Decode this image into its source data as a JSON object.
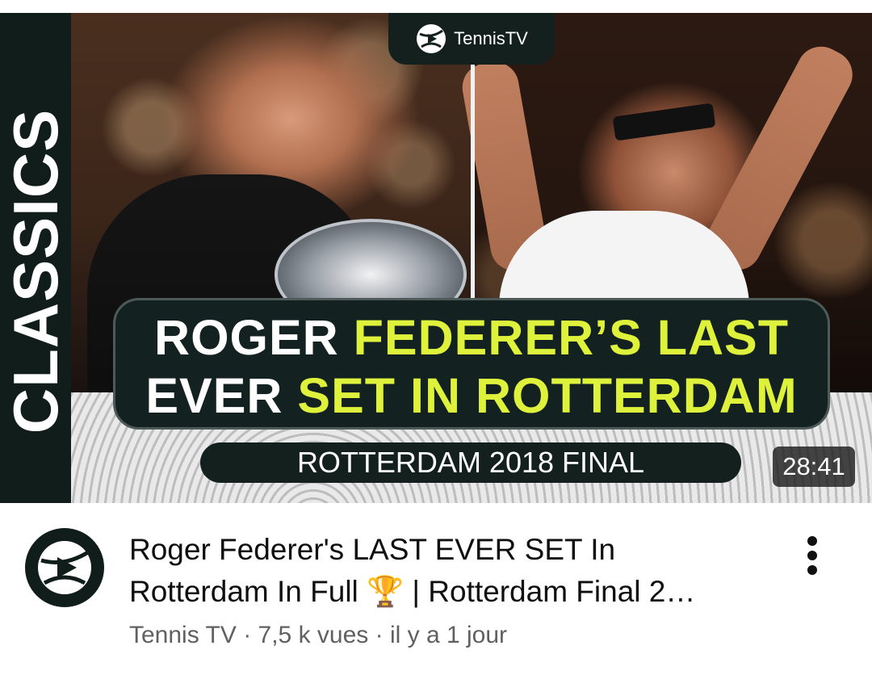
{
  "thumbnail": {
    "side_label": "CLASSICS",
    "logo_text": "TennisTV",
    "headline": {
      "line1_white": "ROGER ",
      "line1_yellow": "FEDERER’S LAST",
      "line2_white": "EVER ",
      "line2_yellow": "SET IN ROTTERDAM"
    },
    "subtitle": "ROTTERDAM 2018 FINAL",
    "duration": "28:41"
  },
  "video": {
    "title_line1": "Roger Federer's LAST EVER SET In",
    "title_line2": "Rotterdam In Full 🏆 | Rotterdam Final 2…",
    "channel": "Tennis TV",
    "separator": " · ",
    "views": "7,5 k vues",
    "age": "il y a 1 jour"
  },
  "icons": {
    "avatar": "tennis-tv-logo-icon",
    "more": "more-vertical-icon"
  },
  "colors": {
    "accent_yellow": "#dff23b",
    "dark_panel": "#132220",
    "meta_gray": "#606060"
  }
}
